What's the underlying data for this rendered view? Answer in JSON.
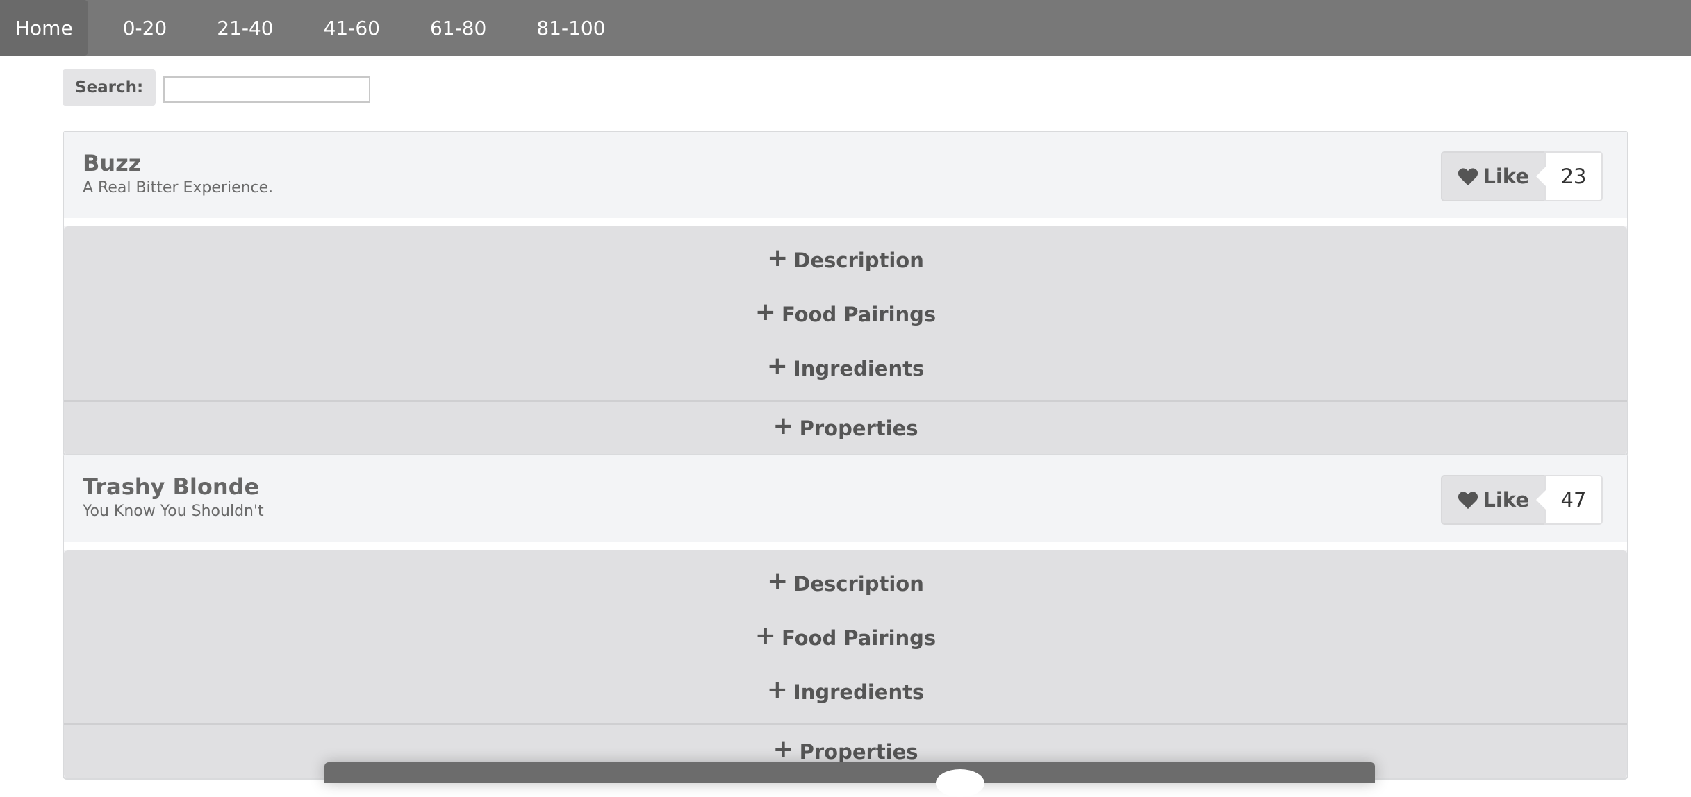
{
  "nav": {
    "items": [
      {
        "label": "Home"
      },
      {
        "label": "0-20"
      },
      {
        "label": "21-40"
      },
      {
        "label": "41-60"
      },
      {
        "label": "61-80"
      },
      {
        "label": "81-100"
      }
    ]
  },
  "search": {
    "label": "Search:",
    "value": "",
    "placeholder": ""
  },
  "beers": [
    {
      "name": "Buzz",
      "tagline": "A Real Bitter Experience.",
      "like_label": "Like",
      "like_count": "23",
      "sections": [
        "Description",
        "Food Pairings",
        "Ingredients"
      ],
      "properties_label": "Properties"
    },
    {
      "name": "Trashy Blonde",
      "tagline": "You Know You Shouldn't",
      "like_label": "Like",
      "like_count": "47",
      "sections": [
        "Description",
        "Food Pairings",
        "Ingredients"
      ],
      "properties_label": "Properties"
    }
  ],
  "icons": {
    "heart": "heart-icon",
    "plus": "+"
  },
  "colors": {
    "nav_bg": "#787878",
    "card_bg": "#f3f3f5",
    "accordion_bg": "#e0e0e2"
  }
}
